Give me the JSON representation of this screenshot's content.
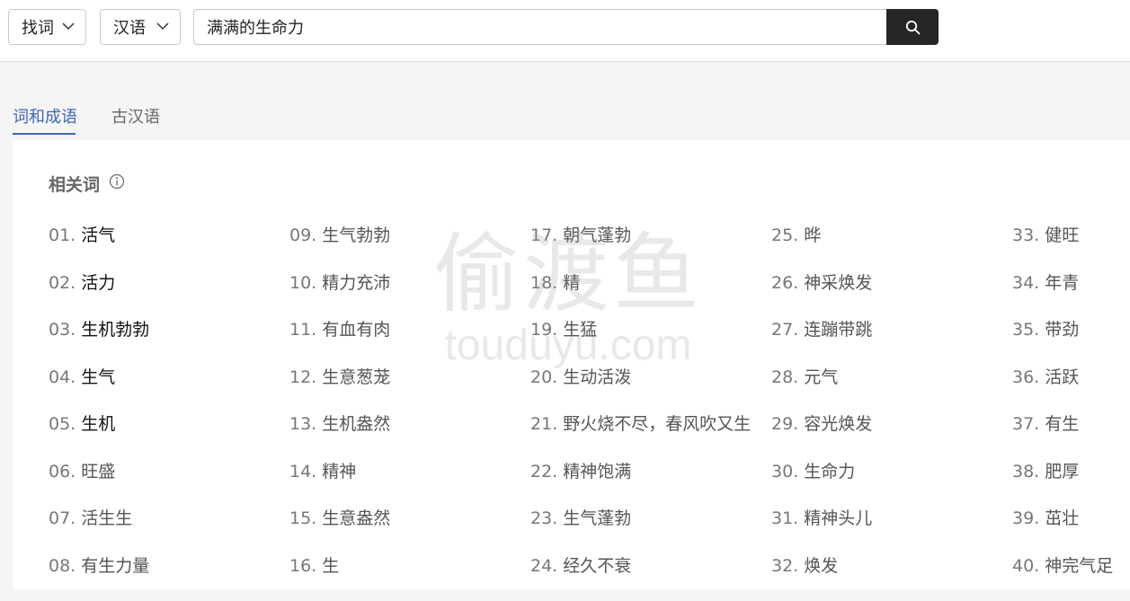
{
  "header": {
    "mode_dropdown": {
      "value": "找词"
    },
    "language_dropdown": {
      "value": "汉语"
    },
    "search": {
      "value": "满满的生命力"
    }
  },
  "tabs": [
    {
      "label": "词和成语",
      "active": true
    },
    {
      "label": "古汉语",
      "active": false
    }
  ],
  "related": {
    "title": "相关词",
    "columns": [
      [
        {
          "num": "01.",
          "word": "活气"
        },
        {
          "num": "02.",
          "word": "活力"
        },
        {
          "num": "03.",
          "word": "生机勃勃"
        },
        {
          "num": "04.",
          "word": "生气"
        },
        {
          "num": "05.",
          "word": "生机"
        },
        {
          "num": "06.",
          "word": "旺盛"
        },
        {
          "num": "07.",
          "word": "活生生"
        },
        {
          "num": "08.",
          "word": "有生力量"
        }
      ],
      [
        {
          "num": "09.",
          "word": "生气勃勃"
        },
        {
          "num": "10.",
          "word": "精力充沛"
        },
        {
          "num": "11.",
          "word": "有血有肉"
        },
        {
          "num": "12.",
          "word": "生意葱茏"
        },
        {
          "num": "13.",
          "word": "生机盎然"
        },
        {
          "num": "14.",
          "word": "精神"
        },
        {
          "num": "15.",
          "word": "生意盎然"
        },
        {
          "num": "16.",
          "word": "生"
        }
      ],
      [
        {
          "num": "17.",
          "word": "朝气蓬勃"
        },
        {
          "num": "18.",
          "word": "精"
        },
        {
          "num": "19.",
          "word": "生猛"
        },
        {
          "num": "20.",
          "word": "生动活泼"
        },
        {
          "num": "21.",
          "word": "野火烧不尽，春风吹又生"
        },
        {
          "num": "22.",
          "word": "精神饱满"
        },
        {
          "num": "23.",
          "word": "生气蓬勃"
        },
        {
          "num": "24.",
          "word": "经久不衰"
        }
      ],
      [
        {
          "num": "25.",
          "word": "晔"
        },
        {
          "num": "26.",
          "word": "神采焕发"
        },
        {
          "num": "27.",
          "word": "连蹦带跳"
        },
        {
          "num": "28.",
          "word": "元气"
        },
        {
          "num": "29.",
          "word": "容光焕发"
        },
        {
          "num": "30.",
          "word": "生命力"
        },
        {
          "num": "31.",
          "word": "精神头儿"
        },
        {
          "num": "32.",
          "word": "焕发"
        }
      ],
      [
        {
          "num": "33.",
          "word": "健旺"
        },
        {
          "num": "34.",
          "word": "年青"
        },
        {
          "num": "35.",
          "word": "带劲"
        },
        {
          "num": "36.",
          "word": "活跃"
        },
        {
          "num": "37.",
          "word": "有生"
        },
        {
          "num": "38.",
          "word": "肥厚"
        },
        {
          "num": "39.",
          "word": "茁壮"
        },
        {
          "num": "40.",
          "word": "神完气足"
        }
      ]
    ]
  },
  "watermark": {
    "cn": "偷渡鱼",
    "en": "touduyu.com"
  },
  "colors": {
    "accent": "#3f67b3",
    "search_button": "#262626"
  },
  "icons": {
    "search": "search-icon",
    "info": "info-icon",
    "dropdown": "chevron-down-icon"
  }
}
